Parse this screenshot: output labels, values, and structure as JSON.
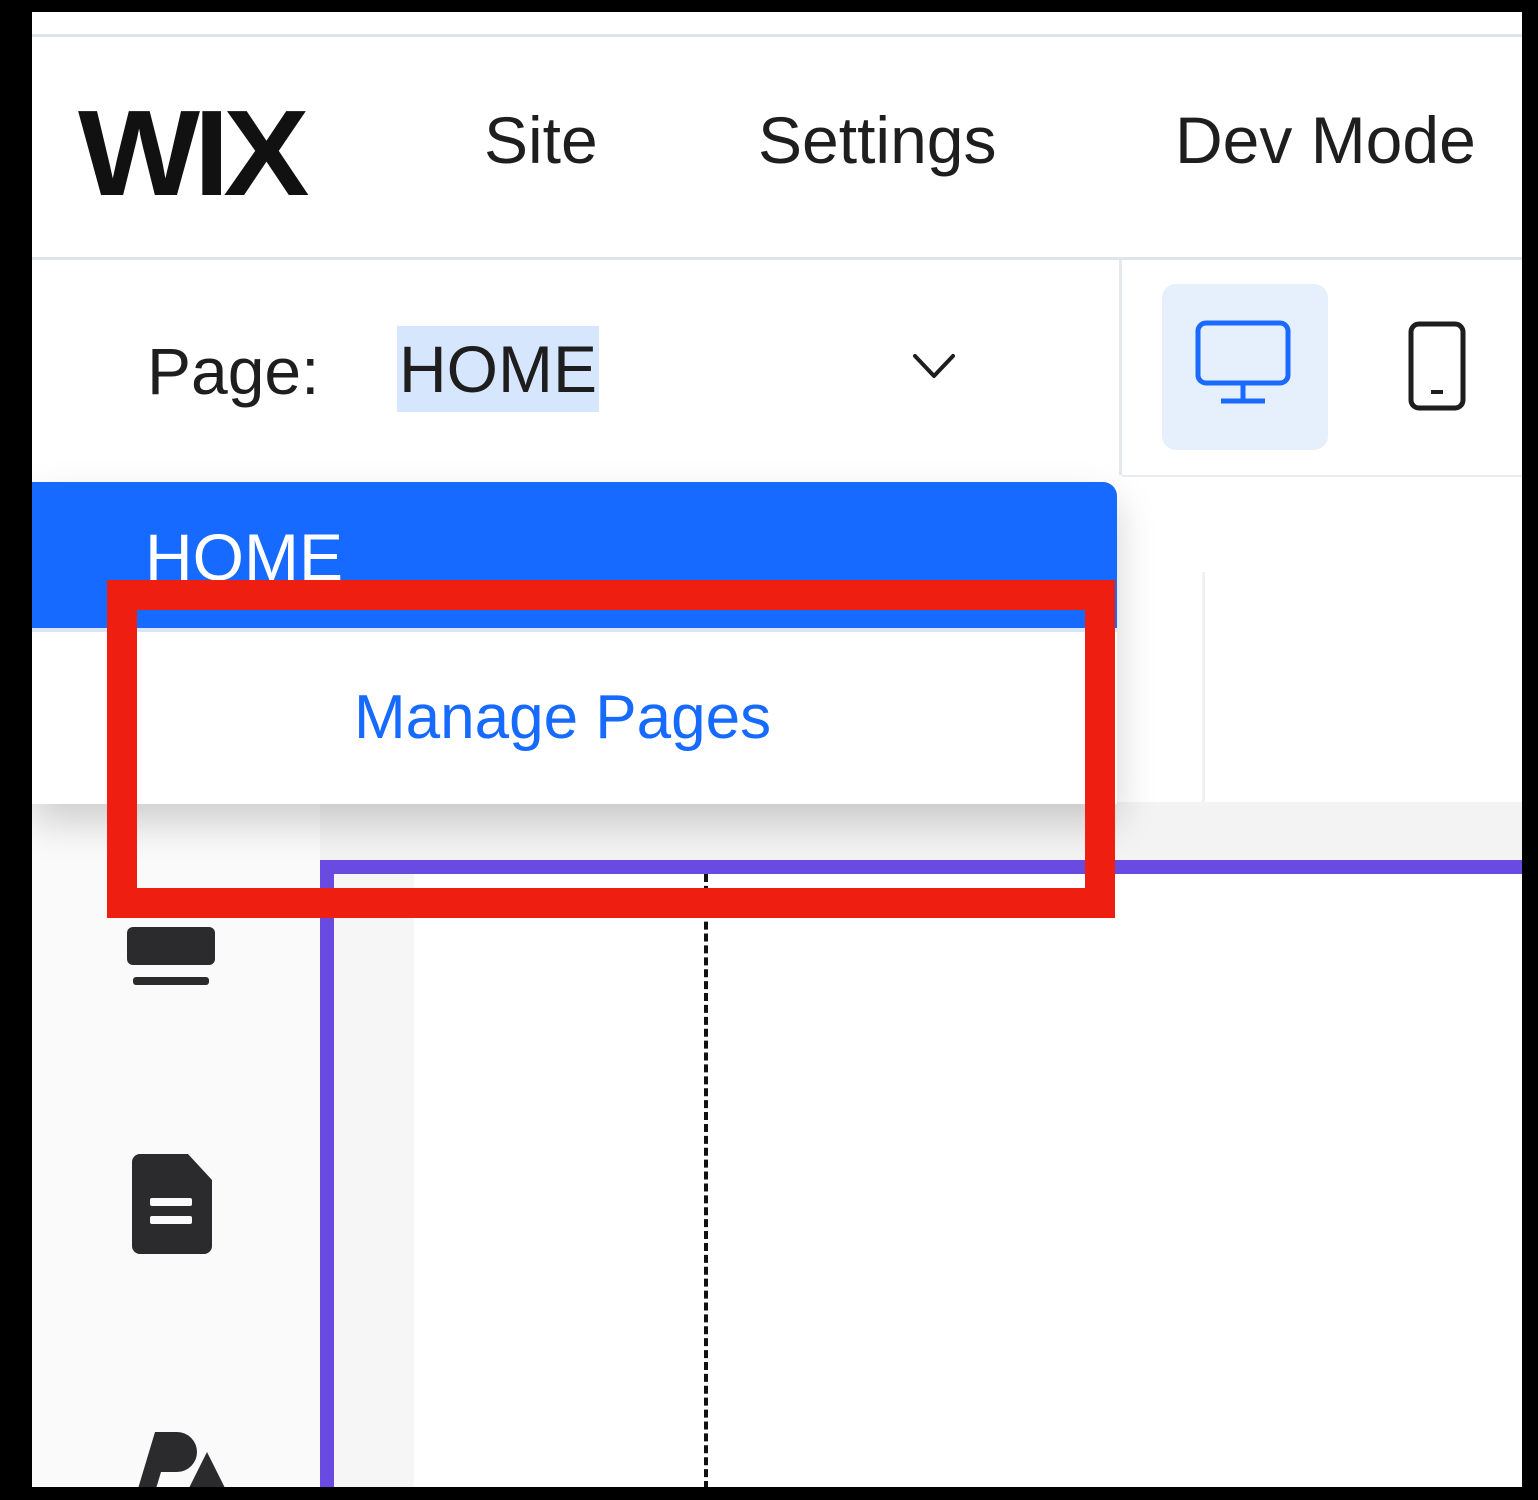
{
  "topbar": {
    "logo": "WIX",
    "menu": [
      "Site",
      "Settings",
      "Dev Mode"
    ]
  },
  "page_selector": {
    "label": "Page:",
    "current_value": "HOME"
  },
  "dropdown": {
    "selected_item": "HOME",
    "manage_label": "Manage Pages"
  },
  "device_toggle": {
    "active": "desktop",
    "options": [
      "desktop",
      "mobile"
    ]
  },
  "colors": {
    "accent_blue": "#166aff",
    "canvas_outline": "#6a4be2",
    "highlight_red": "#ee1e10",
    "selection_bg": "#d6e6fc"
  },
  "icons": [
    "chevron-down-icon",
    "desktop-icon",
    "mobile-icon",
    "sections-icon",
    "pages-icon",
    "design-icon"
  ]
}
